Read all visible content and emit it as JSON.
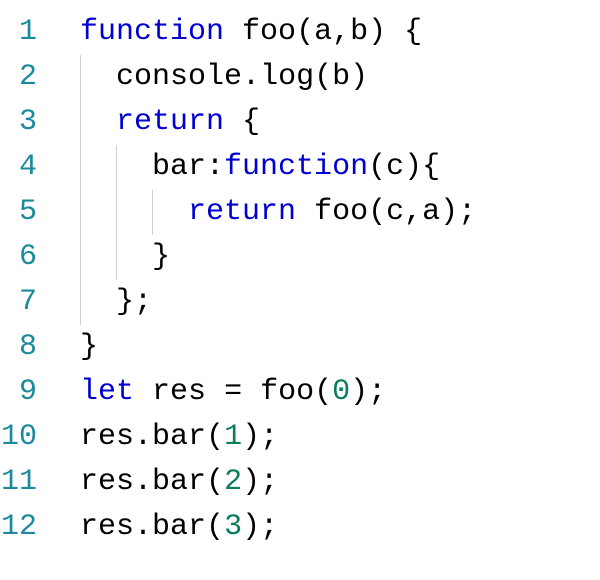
{
  "editor": {
    "lines": [
      {
        "num": "1",
        "guides": [],
        "tokens": [
          {
            "cls": "tok-keyword",
            "text": "function"
          },
          {
            "cls": "tok-punct",
            "text": " "
          },
          {
            "cls": "tok-ident",
            "text": "foo"
          },
          {
            "cls": "tok-punct",
            "text": "("
          },
          {
            "cls": "tok-ident",
            "text": "a"
          },
          {
            "cls": "tok-punct",
            "text": ","
          },
          {
            "cls": "tok-ident",
            "text": "b"
          },
          {
            "cls": "tok-punct",
            "text": ")"
          },
          {
            "cls": "tok-punct",
            "text": " "
          },
          {
            "cls": "tok-punct",
            "text": "{"
          }
        ]
      },
      {
        "num": "2",
        "guides": [
          1
        ],
        "tokens": [
          {
            "cls": "tok-punct",
            "text": "  "
          },
          {
            "cls": "tok-ident",
            "text": "console"
          },
          {
            "cls": "tok-punct",
            "text": "."
          },
          {
            "cls": "tok-ident",
            "text": "log"
          },
          {
            "cls": "tok-punct",
            "text": "("
          },
          {
            "cls": "tok-ident",
            "text": "b"
          },
          {
            "cls": "tok-punct",
            "text": ")"
          }
        ]
      },
      {
        "num": "3",
        "guides": [
          1
        ],
        "tokens": [
          {
            "cls": "tok-punct",
            "text": "  "
          },
          {
            "cls": "tok-keyword",
            "text": "return"
          },
          {
            "cls": "tok-punct",
            "text": " "
          },
          {
            "cls": "tok-punct",
            "text": "{"
          }
        ]
      },
      {
        "num": "4",
        "guides": [
          1,
          2
        ],
        "tokens": [
          {
            "cls": "tok-punct",
            "text": "    "
          },
          {
            "cls": "tok-ident",
            "text": "bar"
          },
          {
            "cls": "tok-punct",
            "text": ":"
          },
          {
            "cls": "tok-keyword",
            "text": "function"
          },
          {
            "cls": "tok-punct",
            "text": "("
          },
          {
            "cls": "tok-ident",
            "text": "c"
          },
          {
            "cls": "tok-punct",
            "text": ")"
          },
          {
            "cls": "tok-punct",
            "text": "{"
          }
        ]
      },
      {
        "num": "5",
        "guides": [
          1,
          2,
          3
        ],
        "tokens": [
          {
            "cls": "tok-punct",
            "text": "      "
          },
          {
            "cls": "tok-keyword",
            "text": "return"
          },
          {
            "cls": "tok-punct",
            "text": " "
          },
          {
            "cls": "tok-ident",
            "text": "foo"
          },
          {
            "cls": "tok-punct",
            "text": "("
          },
          {
            "cls": "tok-ident",
            "text": "c"
          },
          {
            "cls": "tok-punct",
            "text": ","
          },
          {
            "cls": "tok-ident",
            "text": "a"
          },
          {
            "cls": "tok-punct",
            "text": ")"
          },
          {
            "cls": "tok-punct",
            "text": ";"
          }
        ]
      },
      {
        "num": "6",
        "guides": [
          1,
          2
        ],
        "tokens": [
          {
            "cls": "tok-punct",
            "text": "    "
          },
          {
            "cls": "tok-punct",
            "text": "}"
          }
        ]
      },
      {
        "num": "7",
        "guides": [
          1
        ],
        "tokens": [
          {
            "cls": "tok-punct",
            "text": "  "
          },
          {
            "cls": "tok-punct",
            "text": "}"
          },
          {
            "cls": "tok-punct",
            "text": ";"
          }
        ]
      },
      {
        "num": "8",
        "guides": [],
        "tokens": [
          {
            "cls": "tok-punct",
            "text": "}"
          }
        ]
      },
      {
        "num": "9",
        "guides": [],
        "tokens": [
          {
            "cls": "tok-keyword",
            "text": "let"
          },
          {
            "cls": "tok-punct",
            "text": " "
          },
          {
            "cls": "tok-ident",
            "text": "res"
          },
          {
            "cls": "tok-punct",
            "text": " "
          },
          {
            "cls": "tok-punct",
            "text": "="
          },
          {
            "cls": "tok-punct",
            "text": " "
          },
          {
            "cls": "tok-ident",
            "text": "foo"
          },
          {
            "cls": "tok-punct",
            "text": "("
          },
          {
            "cls": "tok-number",
            "text": "0"
          },
          {
            "cls": "tok-punct",
            "text": ")"
          },
          {
            "cls": "tok-punct",
            "text": ";"
          }
        ]
      },
      {
        "num": "10",
        "guides": [],
        "tokens": [
          {
            "cls": "tok-ident",
            "text": "res"
          },
          {
            "cls": "tok-punct",
            "text": "."
          },
          {
            "cls": "tok-ident",
            "text": "bar"
          },
          {
            "cls": "tok-punct",
            "text": "("
          },
          {
            "cls": "tok-number",
            "text": "1"
          },
          {
            "cls": "tok-punct",
            "text": ")"
          },
          {
            "cls": "tok-punct",
            "text": ";"
          }
        ]
      },
      {
        "num": "11",
        "guides": [],
        "tokens": [
          {
            "cls": "tok-ident",
            "text": "res"
          },
          {
            "cls": "tok-punct",
            "text": "."
          },
          {
            "cls": "tok-ident",
            "text": "bar"
          },
          {
            "cls": "tok-punct",
            "text": "("
          },
          {
            "cls": "tok-number",
            "text": "2"
          },
          {
            "cls": "tok-punct",
            "text": ")"
          },
          {
            "cls": "tok-punct",
            "text": ";"
          }
        ]
      },
      {
        "num": "12",
        "guides": [],
        "tokens": [
          {
            "cls": "tok-ident",
            "text": "res"
          },
          {
            "cls": "tok-punct",
            "text": "."
          },
          {
            "cls": "tok-ident",
            "text": "bar"
          },
          {
            "cls": "tok-punct",
            "text": "("
          },
          {
            "cls": "tok-number",
            "text": "3"
          },
          {
            "cls": "tok-punct",
            "text": ")"
          },
          {
            "cls": "tok-punct",
            "text": ";"
          }
        ]
      }
    ]
  },
  "indentWidthCh": 2
}
